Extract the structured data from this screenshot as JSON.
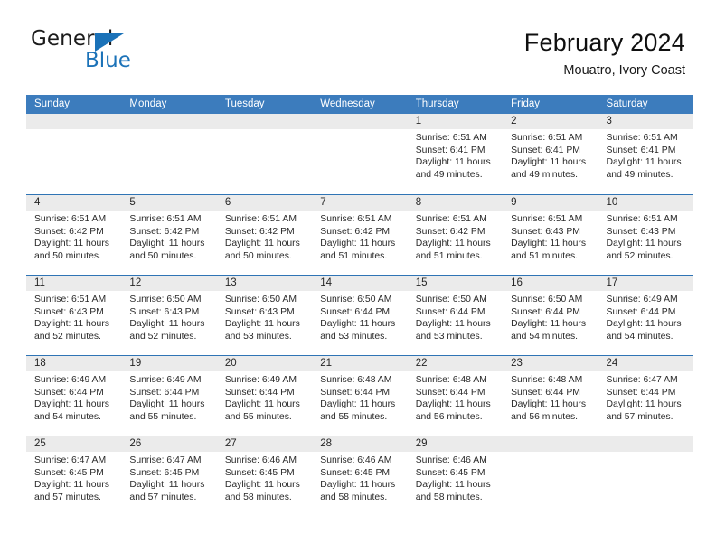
{
  "brand": {
    "name_top": "General",
    "name_bottom": "Blue",
    "triangle_color": "#1b72b8",
    "text_color": "#1b1b1b"
  },
  "header": {
    "title": "February 2024",
    "subtitle": "Mouatro, Ivory Coast"
  },
  "colors": {
    "header_blue": "#3c7cbd",
    "row_rule": "#2f74b5",
    "daynum_band": "#ebebeb",
    "page_background": "#ffffff",
    "text": "#1a1a1a"
  },
  "calendar": {
    "weekday_headers": [
      "Sunday",
      "Monday",
      "Tuesday",
      "Wednesday",
      "Thursday",
      "Friday",
      "Saturday"
    ],
    "labels": {
      "sunrise": "Sunrise:",
      "sunset": "Sunset:",
      "daylight": "Daylight:"
    },
    "weeks": [
      [
        {
          "day": ""
        },
        {
          "day": ""
        },
        {
          "day": ""
        },
        {
          "day": ""
        },
        {
          "day": "1",
          "sunrise": "Sunrise: 6:51 AM",
          "sunset": "Sunset: 6:41 PM",
          "daylight": "Daylight: 11 hours and 49 minutes."
        },
        {
          "day": "2",
          "sunrise": "Sunrise: 6:51 AM",
          "sunset": "Sunset: 6:41 PM",
          "daylight": "Daylight: 11 hours and 49 minutes."
        },
        {
          "day": "3",
          "sunrise": "Sunrise: 6:51 AM",
          "sunset": "Sunset: 6:41 PM",
          "daylight": "Daylight: 11 hours and 49 minutes."
        }
      ],
      [
        {
          "day": "4",
          "sunrise": "Sunrise: 6:51 AM",
          "sunset": "Sunset: 6:42 PM",
          "daylight": "Daylight: 11 hours and 50 minutes."
        },
        {
          "day": "5",
          "sunrise": "Sunrise: 6:51 AM",
          "sunset": "Sunset: 6:42 PM",
          "daylight": "Daylight: 11 hours and 50 minutes."
        },
        {
          "day": "6",
          "sunrise": "Sunrise: 6:51 AM",
          "sunset": "Sunset: 6:42 PM",
          "daylight": "Daylight: 11 hours and 50 minutes."
        },
        {
          "day": "7",
          "sunrise": "Sunrise: 6:51 AM",
          "sunset": "Sunset: 6:42 PM",
          "daylight": "Daylight: 11 hours and 51 minutes."
        },
        {
          "day": "8",
          "sunrise": "Sunrise: 6:51 AM",
          "sunset": "Sunset: 6:42 PM",
          "daylight": "Daylight: 11 hours and 51 minutes."
        },
        {
          "day": "9",
          "sunrise": "Sunrise: 6:51 AM",
          "sunset": "Sunset: 6:43 PM",
          "daylight": "Daylight: 11 hours and 51 minutes."
        },
        {
          "day": "10",
          "sunrise": "Sunrise: 6:51 AM",
          "sunset": "Sunset: 6:43 PM",
          "daylight": "Daylight: 11 hours and 52 minutes."
        }
      ],
      [
        {
          "day": "11",
          "sunrise": "Sunrise: 6:51 AM",
          "sunset": "Sunset: 6:43 PM",
          "daylight": "Daylight: 11 hours and 52 minutes."
        },
        {
          "day": "12",
          "sunrise": "Sunrise: 6:50 AM",
          "sunset": "Sunset: 6:43 PM",
          "daylight": "Daylight: 11 hours and 52 minutes."
        },
        {
          "day": "13",
          "sunrise": "Sunrise: 6:50 AM",
          "sunset": "Sunset: 6:43 PM",
          "daylight": "Daylight: 11 hours and 53 minutes."
        },
        {
          "day": "14",
          "sunrise": "Sunrise: 6:50 AM",
          "sunset": "Sunset: 6:44 PM",
          "daylight": "Daylight: 11 hours and 53 minutes."
        },
        {
          "day": "15",
          "sunrise": "Sunrise: 6:50 AM",
          "sunset": "Sunset: 6:44 PM",
          "daylight": "Daylight: 11 hours and 53 minutes."
        },
        {
          "day": "16",
          "sunrise": "Sunrise: 6:50 AM",
          "sunset": "Sunset: 6:44 PM",
          "daylight": "Daylight: 11 hours and 54 minutes."
        },
        {
          "day": "17",
          "sunrise": "Sunrise: 6:49 AM",
          "sunset": "Sunset: 6:44 PM",
          "daylight": "Daylight: 11 hours and 54 minutes."
        }
      ],
      [
        {
          "day": "18",
          "sunrise": "Sunrise: 6:49 AM",
          "sunset": "Sunset: 6:44 PM",
          "daylight": "Daylight: 11 hours and 54 minutes."
        },
        {
          "day": "19",
          "sunrise": "Sunrise: 6:49 AM",
          "sunset": "Sunset: 6:44 PM",
          "daylight": "Daylight: 11 hours and 55 minutes."
        },
        {
          "day": "20",
          "sunrise": "Sunrise: 6:49 AM",
          "sunset": "Sunset: 6:44 PM",
          "daylight": "Daylight: 11 hours and 55 minutes."
        },
        {
          "day": "21",
          "sunrise": "Sunrise: 6:48 AM",
          "sunset": "Sunset: 6:44 PM",
          "daylight": "Daylight: 11 hours and 55 minutes."
        },
        {
          "day": "22",
          "sunrise": "Sunrise: 6:48 AM",
          "sunset": "Sunset: 6:44 PM",
          "daylight": "Daylight: 11 hours and 56 minutes."
        },
        {
          "day": "23",
          "sunrise": "Sunrise: 6:48 AM",
          "sunset": "Sunset: 6:44 PM",
          "daylight": "Daylight: 11 hours and 56 minutes."
        },
        {
          "day": "24",
          "sunrise": "Sunrise: 6:47 AM",
          "sunset": "Sunset: 6:44 PM",
          "daylight": "Daylight: 11 hours and 57 minutes."
        }
      ],
      [
        {
          "day": "25",
          "sunrise": "Sunrise: 6:47 AM",
          "sunset": "Sunset: 6:45 PM",
          "daylight": "Daylight: 11 hours and 57 minutes."
        },
        {
          "day": "26",
          "sunrise": "Sunrise: 6:47 AM",
          "sunset": "Sunset: 6:45 PM",
          "daylight": "Daylight: 11 hours and 57 minutes."
        },
        {
          "day": "27",
          "sunrise": "Sunrise: 6:46 AM",
          "sunset": "Sunset: 6:45 PM",
          "daylight": "Daylight: 11 hours and 58 minutes."
        },
        {
          "day": "28",
          "sunrise": "Sunrise: 6:46 AM",
          "sunset": "Sunset: 6:45 PM",
          "daylight": "Daylight: 11 hours and 58 minutes."
        },
        {
          "day": "29",
          "sunrise": "Sunrise: 6:46 AM",
          "sunset": "Sunset: 6:45 PM",
          "daylight": "Daylight: 11 hours and 58 minutes."
        },
        {
          "day": ""
        },
        {
          "day": ""
        }
      ]
    ]
  }
}
